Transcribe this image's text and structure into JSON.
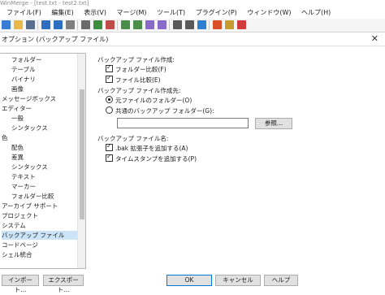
{
  "window": {
    "title": "WinMerge - [test.txt - test2.txt]"
  },
  "menu": [
    {
      "label": "ファイル(F)"
    },
    {
      "label": "編集(E)"
    },
    {
      "label": "表示(V)"
    },
    {
      "label": "マージ(M)"
    },
    {
      "label": "ツール(T)"
    },
    {
      "label": "プラグイン(P)"
    },
    {
      "label": "ウィンドウ(W)"
    },
    {
      "label": "ヘルプ(H)"
    }
  ],
  "toolbar_icons": [
    {
      "name": "new-icon",
      "color": "#3a7bd5"
    },
    {
      "name": "open-icon",
      "color": "#e8b84a"
    },
    {
      "name": "save-icon",
      "color": "#5a6f8f"
    },
    {
      "name": "undo-icon",
      "color": "#2e6fc2"
    },
    {
      "name": "redo-icon",
      "color": "#2e6fc2"
    },
    {
      "name": "print-icon",
      "color": "#7f7f7f"
    },
    {
      "name": "options-icon",
      "color": "#6a6a6a"
    },
    {
      "name": "filter-icon",
      "color": "#3c8d3c"
    },
    {
      "name": "compare-icon",
      "color": "#c04a4a"
    },
    {
      "name": "next-diff-icon",
      "color": "#4a8e4a"
    },
    {
      "name": "prev-diff-icon",
      "color": "#4a8e4a"
    },
    {
      "name": "first-diff-icon",
      "color": "#8a6ac8"
    },
    {
      "name": "last-diff-icon",
      "color": "#8a6ac8"
    },
    {
      "name": "copy-right-icon",
      "color": "#5a5a5a"
    },
    {
      "name": "copy-left-icon",
      "color": "#5a5a5a"
    },
    {
      "name": "merge-icon",
      "color": "#2f7fd1"
    },
    {
      "name": "refresh-icon",
      "color": "#d94f2a"
    },
    {
      "name": "move-icon",
      "color": "#c89b2e"
    },
    {
      "name": "color-icon",
      "color": "#d13b3b"
    }
  ],
  "dialog": {
    "title": "オプション (バックアップ ファイル)",
    "close_glyph": "✕"
  },
  "tree": {
    "items": [
      {
        "label": "フォルダー",
        "indent": 1
      },
      {
        "label": "テーブル",
        "indent": 1
      },
      {
        "label": "バイナリ",
        "indent": 1
      },
      {
        "label": "画像",
        "indent": 1
      },
      {
        "label": "メッセージボックス",
        "indent": 0
      },
      {
        "label": "エディター",
        "indent": 0
      },
      {
        "label": "一般",
        "indent": 1
      },
      {
        "label": "シンタックス",
        "indent": 1
      },
      {
        "label": "色",
        "indent": 0
      },
      {
        "label": "配色",
        "indent": 1
      },
      {
        "label": "差異",
        "indent": 1
      },
      {
        "label": "シンタックス",
        "indent": 1
      },
      {
        "label": "テキスト",
        "indent": 1
      },
      {
        "label": "マーカー",
        "indent": 1
      },
      {
        "label": "フォルダー比較",
        "indent": 1
      },
      {
        "label": "アーカイブ サポート",
        "indent": 0
      },
      {
        "label": "プロジェクト",
        "indent": 0
      },
      {
        "label": "システム",
        "indent": 0
      },
      {
        "label": "バックアップ ファイル",
        "indent": 0,
        "selected": true
      },
      {
        "label": "コードページ",
        "indent": 0
      },
      {
        "label": "シェル統合",
        "indent": 0
      }
    ]
  },
  "backup": {
    "create_label": "バックアップ ファイル作成:",
    "folder_compare_label": "フォルダー比較(F)",
    "folder_compare_checked": true,
    "file_compare_label": "ファイル比較(E)",
    "file_compare_checked": true,
    "location_label": "バックアップ ファイル作成先:",
    "original_folder_label": "元ファイルのフォルダー(O)",
    "original_folder_selected": true,
    "common_folder_label": "共通のバックアップ フォルダー(G):",
    "common_folder_selected": false,
    "folder_value": "",
    "browse_label": "参照...",
    "name_label": "バックアップ ファイル名:",
    "bak_ext_label": ".bak 拡張子を追加する(A)",
    "bak_ext_checked": true,
    "timestamp_label": "タイムスタンプを追加する(P)",
    "timestamp_checked": true,
    "check_glyph": "✓"
  },
  "footer": {
    "import_label": "インポート...",
    "export_label": "エクスポート...",
    "ok_label": "OK",
    "cancel_label": "キャンセル",
    "help_label": "ヘルプ"
  }
}
